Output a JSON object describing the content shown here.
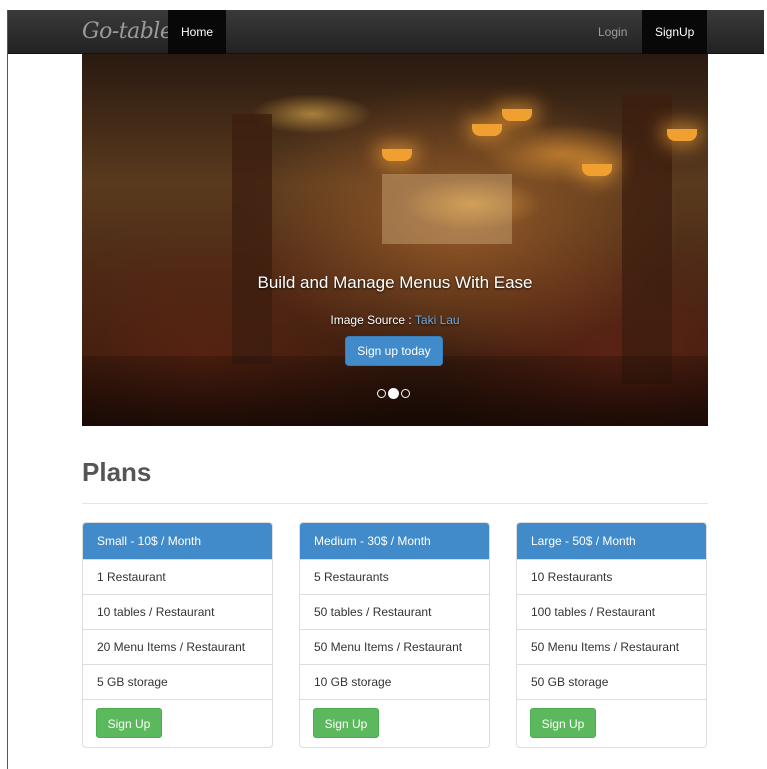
{
  "navbar": {
    "brand": "Go-table",
    "home_label": "Home",
    "login_label": "Login",
    "signup_label": "SignUp"
  },
  "hero": {
    "title": "Build and Manage Menus With Ease",
    "source_prefix": "Image Source : ",
    "source_link": "Taki Lau",
    "cta_label": "Sign up today",
    "active_slide": 2,
    "slide_count": 3
  },
  "plans": {
    "heading": "Plans",
    "items": [
      {
        "title": "Small - 10$ / Month",
        "features": [
          "1 Restaurant",
          "10 tables / Restaurant",
          "20 Menu Items / Restaurant",
          "5 GB storage"
        ],
        "button": "Sign Up"
      },
      {
        "title": "Medium - 30$ / Month",
        "features": [
          "5 Restaurants",
          "50 tables / Restaurant",
          "50 Menu Items / Restaurant",
          "10 GB storage"
        ],
        "button": "Sign Up"
      },
      {
        "title": "Large - 50$ / Month",
        "features": [
          "10 Restaurants",
          "100 tables / Restaurant",
          "50 Menu Items / Restaurant",
          "50 GB storage"
        ],
        "button": "Sign Up"
      }
    ]
  },
  "colors": {
    "navbar": "#222222",
    "primary": "#428bca",
    "success": "#5cb85c"
  }
}
